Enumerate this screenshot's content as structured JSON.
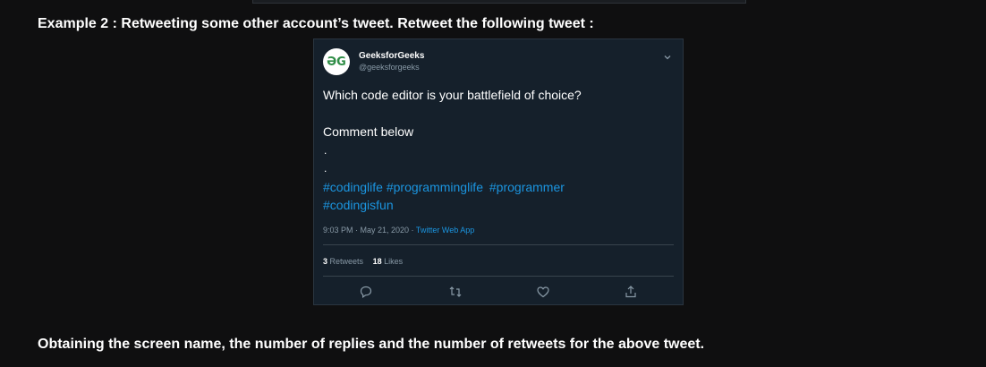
{
  "example": {
    "label": "Example 2 :",
    "text": "Retweeting some other account’s tweet. Retweet the following tweet :"
  },
  "tweet": {
    "avatar_text": "ƏG",
    "display_name": "GeeksforGeeks",
    "handle": "@geeksforgeeks",
    "line1": "Which code editor is your battlefield of choice?",
    "line2": "Comment below",
    "dot1": ".",
    "dot2": ".",
    "hashtags_row1": [
      "#codinglife",
      "#programminglife",
      "#programmer"
    ],
    "hashtags_row2": [
      "#codingisfun"
    ],
    "timestamp": "9:03 PM · May 21, 2020 · ",
    "source": "Twitter Web App",
    "retweets_count": "3",
    "retweets_label": "Retweets",
    "likes_count": "18",
    "likes_label": "Likes",
    "icons": [
      "reply-icon",
      "retweet-icon",
      "like-icon",
      "share-icon"
    ]
  },
  "caption": "Obtaining the screen name, the number of replies and the number of retweets for the above tweet.",
  "colors": {
    "page_bg": "#0f0f10",
    "card_bg": "#15202b",
    "link": "#1b95e0",
    "muted": "#8899a6"
  }
}
